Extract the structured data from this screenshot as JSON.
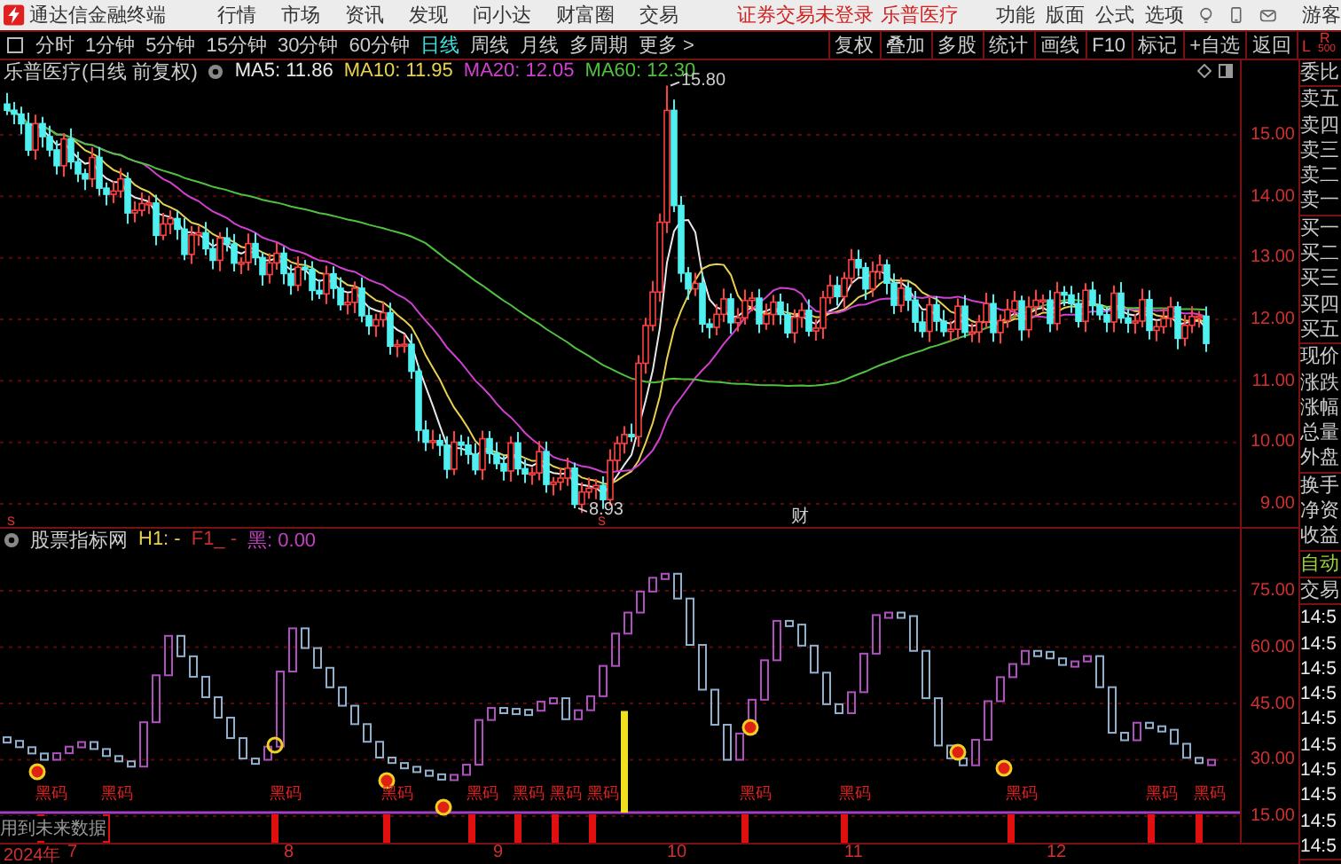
{
  "app": {
    "title": "通达信金融终端"
  },
  "menu": [
    "行情",
    "市场",
    "资讯",
    "发现",
    "问小达",
    "财富圈",
    "交易"
  ],
  "login_notice": "证券交易未登录",
  "top_stock": "乐普医疗",
  "top_menu_right": [
    "功能",
    "版面",
    "公式",
    "选项"
  ],
  "user": "游客",
  "period_tabs": [
    {
      "label": "分时",
      "selected": false
    },
    {
      "label": "1分钟",
      "selected": false
    },
    {
      "label": "5分钟",
      "selected": false
    },
    {
      "label": "15分钟",
      "selected": false
    },
    {
      "label": "30分钟",
      "selected": false
    },
    {
      "label": "60分钟",
      "selected": false
    },
    {
      "label": "日线",
      "selected": true
    },
    {
      "label": "周线",
      "selected": false
    },
    {
      "label": "月线",
      "selected": false
    },
    {
      "label": "多周期",
      "selected": false
    },
    {
      "label": "更多 >",
      "selected": false
    }
  ],
  "tool_buttons": [
    "复权",
    "叠加",
    "多股",
    "统计",
    "画线",
    "F10",
    "标记",
    "+自选",
    "返回"
  ],
  "lr_box": {
    "left": "L",
    "right": "R",
    "size": "500"
  },
  "chart": {
    "title": "乐普医疗(日线 前复权)",
    "ma": [
      {
        "label": "MA5: 11.86",
        "color": "#e8e8e8"
      },
      {
        "label": "MA10: 11.95",
        "color": "#e8d050"
      },
      {
        "label": "MA20: 12.05",
        "color": "#d040d0"
      },
      {
        "label": "MA60: 12.30",
        "color": "#50c040"
      }
    ],
    "price_ticks": [
      "15.00",
      "14.00",
      "13.00",
      "12.00",
      "11.00",
      "10.00",
      "9.00"
    ],
    "high_label": "15.80",
    "low_label": "8.93",
    "event_marker": "财",
    "split_markers": [
      "s",
      "s"
    ]
  },
  "indicator": {
    "name": "股票指标网",
    "values": [
      {
        "label": "H1: -",
        "color": "#e8d050"
      },
      {
        "label": "F1_ -",
        "color": "#c03030"
      },
      {
        "label": "黑: 0.00",
        "color": "#c040c0"
      }
    ],
    "ticks": [
      "75.00",
      "60.00",
      "45.00",
      "30.00",
      "15.00"
    ],
    "signal_labels": [
      "黑码",
      "黑码",
      "黑码",
      "黑码",
      "黑码",
      "黑码",
      "黑码",
      "黑码",
      "黑码",
      "黑码",
      "黑码",
      "黑码",
      "黑码"
    ],
    "note": "用到未来数据"
  },
  "date_axis": [
    "2024年",
    "7",
    "8",
    "9",
    "10",
    "11",
    "12"
  ],
  "quote_panel": [
    {
      "kind": "label",
      "items": [
        "委比"
      ]
    },
    {
      "kind": "label",
      "items": [
        "卖五",
        "卖四",
        "卖三",
        "卖二",
        "卖一"
      ]
    },
    {
      "kind": "label",
      "items": [
        "买一",
        "买二",
        "买三",
        "买四",
        "买五"
      ]
    },
    {
      "kind": "label",
      "items": [
        "现价",
        "涨跌",
        "涨幅",
        "总量",
        "外盘"
      ]
    },
    {
      "kind": "label",
      "items": [
        "换手",
        "净资",
        "收益"
      ]
    },
    {
      "kind": "status",
      "items": [
        "自动"
      ]
    },
    {
      "kind": "label",
      "items": [
        "交易"
      ]
    },
    {
      "kind": "time",
      "items": [
        "14:5",
        "14:5",
        "14:5",
        "14:5",
        "14:5",
        "14:5",
        "14:5",
        "14:5",
        "14:5",
        "14:5"
      ]
    }
  ]
}
